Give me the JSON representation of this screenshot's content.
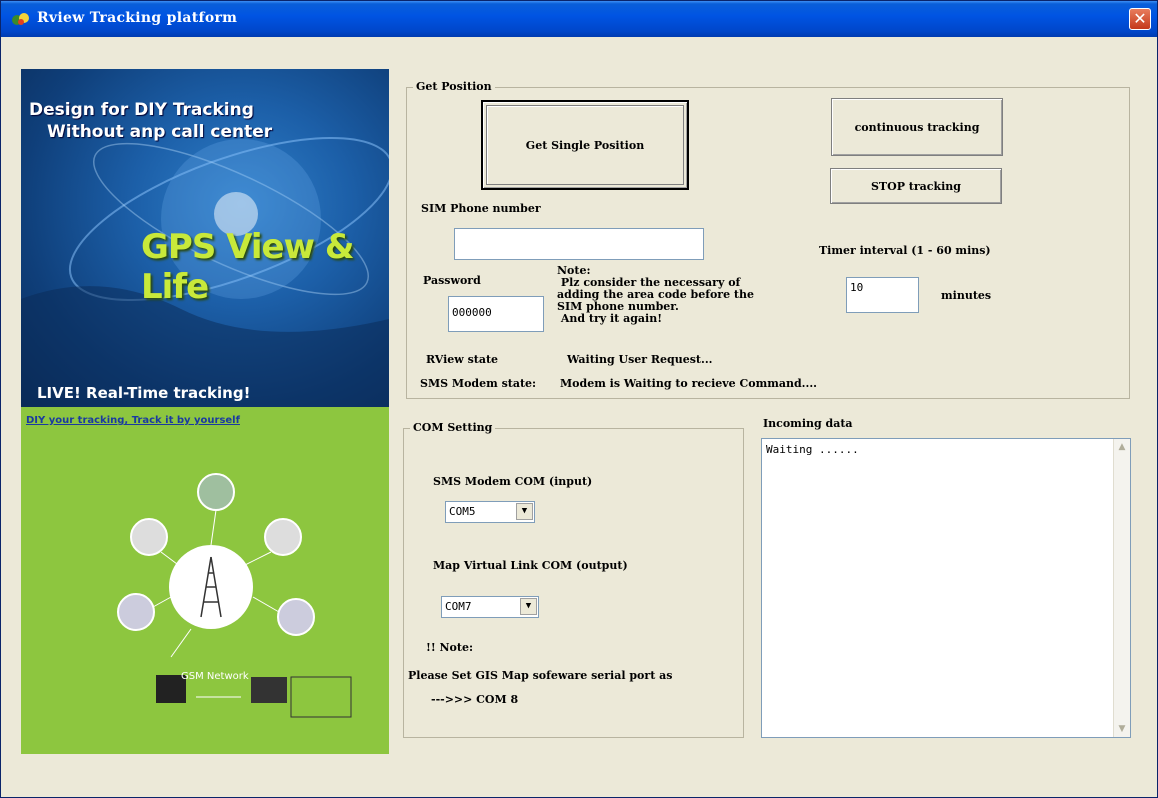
{
  "window": {
    "title": "Rview Tracking platform"
  },
  "banner": {
    "line1": "Design for DIY Tracking",
    "line2": "Without anp call center",
    "brand": "GPS View & Life",
    "live": "LIVE! Real-Time tracking!",
    "diy": "DIY your tracking, Track it by yourself",
    "gsm": "GSM Network"
  },
  "get_position": {
    "group_label": "Get Position",
    "single_button": "Get Single Position",
    "continuous_button": "continuous tracking",
    "stop_button": "STOP tracking",
    "sim_label": "SIM Phone number",
    "sim_value": "",
    "timer_label": "Timer interval  (1 - 60 mins)",
    "password_label": "Password",
    "password_value": "000000",
    "note_text": "Note:\n Plz consider the necessary of\nadding the area code before the\nSIM phone number.\n And try it again!",
    "timer_value": "10",
    "minutes_label": "minutes",
    "rview_state_label": "RView state",
    "rview_state_value": "Waiting User Request...",
    "sms_state_label": "SMS Modem state:",
    "sms_state_value": "Modem is Waiting to recieve Command...."
  },
  "com_setting": {
    "group_label": "COM  Setting",
    "sms_com_label": "SMS Modem COM  (input)",
    "sms_com_value": "COM5",
    "map_com_label": "Map Virtual Link COM  (output)",
    "map_com_value": "COM7",
    "note_label": "!!  Note:",
    "note_line1": "Please Set GIS Map sofeware serial port as",
    "note_line2": "--->>> COM 8"
  },
  "incoming": {
    "label": "Incoming data",
    "content": "Waiting ......"
  }
}
